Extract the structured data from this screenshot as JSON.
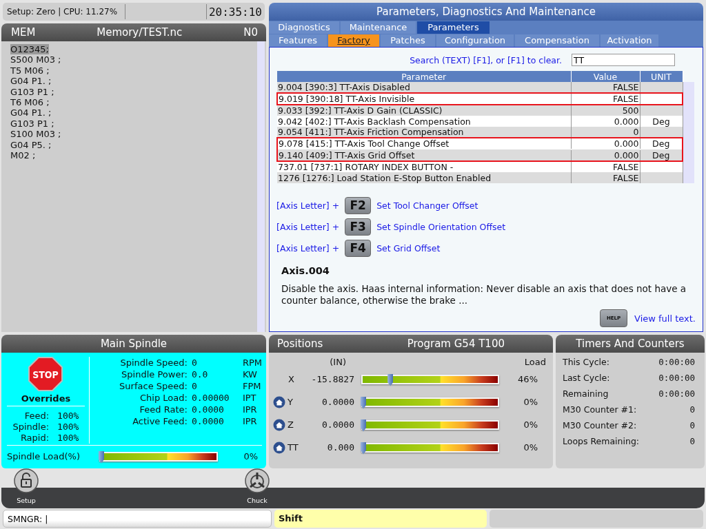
{
  "status_bar": {
    "text": "Setup: Zero | CPU: 11.27%",
    "time": "20:35:10"
  },
  "program": {
    "mode": "MEM",
    "file": "Memory/TEST.nc",
    "line": "N0",
    "lines": [
      {
        "text": "O12345;",
        "selected": true
      },
      {
        "text": "S500 M03 ;",
        "selected": false
      },
      {
        "text": "T5 M06 ;",
        "selected": false
      },
      {
        "text": "G04 P1. ;",
        "selected": false
      },
      {
        "text": "G103 P1 ;",
        "selected": false
      },
      {
        "text": "T6 M06 ;",
        "selected": false
      },
      {
        "text": "G04 P1. ;",
        "selected": false
      },
      {
        "text": "G103 P1 ;",
        "selected": false
      },
      {
        "text": "S100 M03 ;",
        "selected": false
      },
      {
        "text": "G04 P5. ;",
        "selected": false
      },
      {
        "text": "M02 ;",
        "selected": false
      }
    ]
  },
  "params": {
    "title": "Parameters, Diagnostics And Maintenance",
    "tabs": [
      {
        "label": "Diagnostics",
        "selected": false
      },
      {
        "label": "Maintenance",
        "selected": false
      },
      {
        "label": "Parameters",
        "selected": true
      }
    ],
    "subtabs": [
      {
        "label": "Features",
        "selected": false
      },
      {
        "label": "Factory",
        "selected": true
      },
      {
        "label": "Patches",
        "selected": false
      },
      {
        "label": "Configuration",
        "selected": false
      },
      {
        "label": "Compensation",
        "selected": false
      },
      {
        "label": "Activation",
        "selected": false
      }
    ],
    "search": {
      "label": "Search (TEXT) [F1], or [F1] to clear.",
      "value": "TT"
    },
    "columns": [
      "Parameter",
      "Value",
      "UNIT"
    ],
    "rows": [
      {
        "parameter": "9.004 [390:3] TT-Axis Disabled",
        "value": "FALSE",
        "unit": "",
        "outlined": false
      },
      {
        "parameter": "9.019 [390:18] TT-Axis Invisible",
        "value": "FALSE",
        "unit": "",
        "outlined": true
      },
      {
        "parameter": "9.033 [392:] TT-Axis D Gain (CLASSIC)",
        "value": "500",
        "unit": "",
        "outlined": false
      },
      {
        "parameter": "9.042 [402:] TT-Axis Backlash Compensation",
        "value": "0.000",
        "unit": "Deg",
        "outlined": false
      },
      {
        "parameter": "9.054 [411:] TT-Axis Friction Compensation",
        "value": "0",
        "unit": "",
        "outlined": false
      },
      {
        "parameter": "9.078 [415:] TT-Axis Tool Change Offset",
        "value": "0.000",
        "unit": "Deg",
        "outlined": true
      },
      {
        "parameter": "9.140 [409:] TT-Axis Grid Offset",
        "value": "0.000",
        "unit": "Deg",
        "outlined": true
      },
      {
        "parameter": "737.01 [737:1] ROTARY INDEX BUTTON -",
        "value": "FALSE",
        "unit": "",
        "outlined": false
      },
      {
        "parameter": "1276 [1276:] Load Station E-Stop Button Enabled",
        "value": "FALSE",
        "unit": "",
        "outlined": false
      }
    ],
    "shortcuts": [
      {
        "prefix": "[Axis Letter] +",
        "key": "F2",
        "action": "Set Tool Changer Offset"
      },
      {
        "prefix": "[Axis Letter] +",
        "key": "F3",
        "action": "Set Spindle Orientation Offset"
      },
      {
        "prefix": "[Axis Letter] +",
        "key": "F4",
        "action": "Set Grid Offset"
      }
    ],
    "help": {
      "title": "Axis.004",
      "text": "Disable the axis. Haas internal information: Never disable an axis that does not have a counter balance, otherwise the brake ...",
      "key": "HELP",
      "link": "View full text."
    }
  },
  "spindle": {
    "title": "Main Spindle",
    "stop": "STOP",
    "overrides_title": "Overrides",
    "overrides": [
      {
        "label": "Feed:",
        "value": "100%"
      },
      {
        "label": "Spindle:",
        "value": "100%"
      },
      {
        "label": "Rapid:",
        "value": "100%"
      }
    ],
    "stats": [
      {
        "label": "Spindle Speed:",
        "value": "0",
        "unit": "RPM"
      },
      {
        "label": "Spindle Power:",
        "value": "0.0",
        "unit": "KW"
      },
      {
        "label": "Surface Speed:",
        "value": "0",
        "unit": "FPM"
      },
      {
        "label": "Chip Load:",
        "value": "0.00000",
        "unit": "IPT"
      },
      {
        "label": "Feed Rate:",
        "value": "0.0000",
        "unit": "IPR"
      },
      {
        "label": "Active Feed:",
        "value": "0.0000",
        "unit": "IPR"
      }
    ],
    "load": {
      "label": "Spindle Load(%)",
      "level": 0,
      "reading": "0%"
    }
  },
  "positions": {
    "title": "Positions",
    "program": "Program G54 T100",
    "unit_header": "(IN)",
    "load_header": "Load",
    "axes": [
      {
        "name": "X",
        "value": "-15.8827",
        "level": 0.2,
        "reading": "46%",
        "home": false
      },
      {
        "name": "Y",
        "value": "0.0000",
        "level": 0,
        "reading": "0%",
        "home": true
      },
      {
        "name": "Z",
        "value": "0.0000",
        "level": 0,
        "reading": "0%",
        "home": true
      },
      {
        "name": "TT",
        "value": "0.000",
        "level": 0,
        "reading": "0%",
        "home": true
      }
    ]
  },
  "timers": {
    "title": "Timers And Counters",
    "items": [
      {
        "label": "This Cycle:",
        "value": "0:00:00"
      },
      {
        "label": "Last Cycle:",
        "value": "0:00:00"
      },
      {
        "label": "Remaining",
        "value": "0:00:00"
      },
      {
        "label": "M30 Counter #1:",
        "value": "0"
      },
      {
        "label": "M30 Counter #2:",
        "value": "0"
      },
      {
        "label": "Loops Remaining:",
        "value": "0"
      }
    ]
  },
  "dock": [
    {
      "label": "Setup",
      "kind": "lock"
    },
    {
      "label": "Chuck",
      "kind": "chuck"
    }
  ],
  "command": {
    "value": "SMNGR: |",
    "mode": "Shift"
  }
}
